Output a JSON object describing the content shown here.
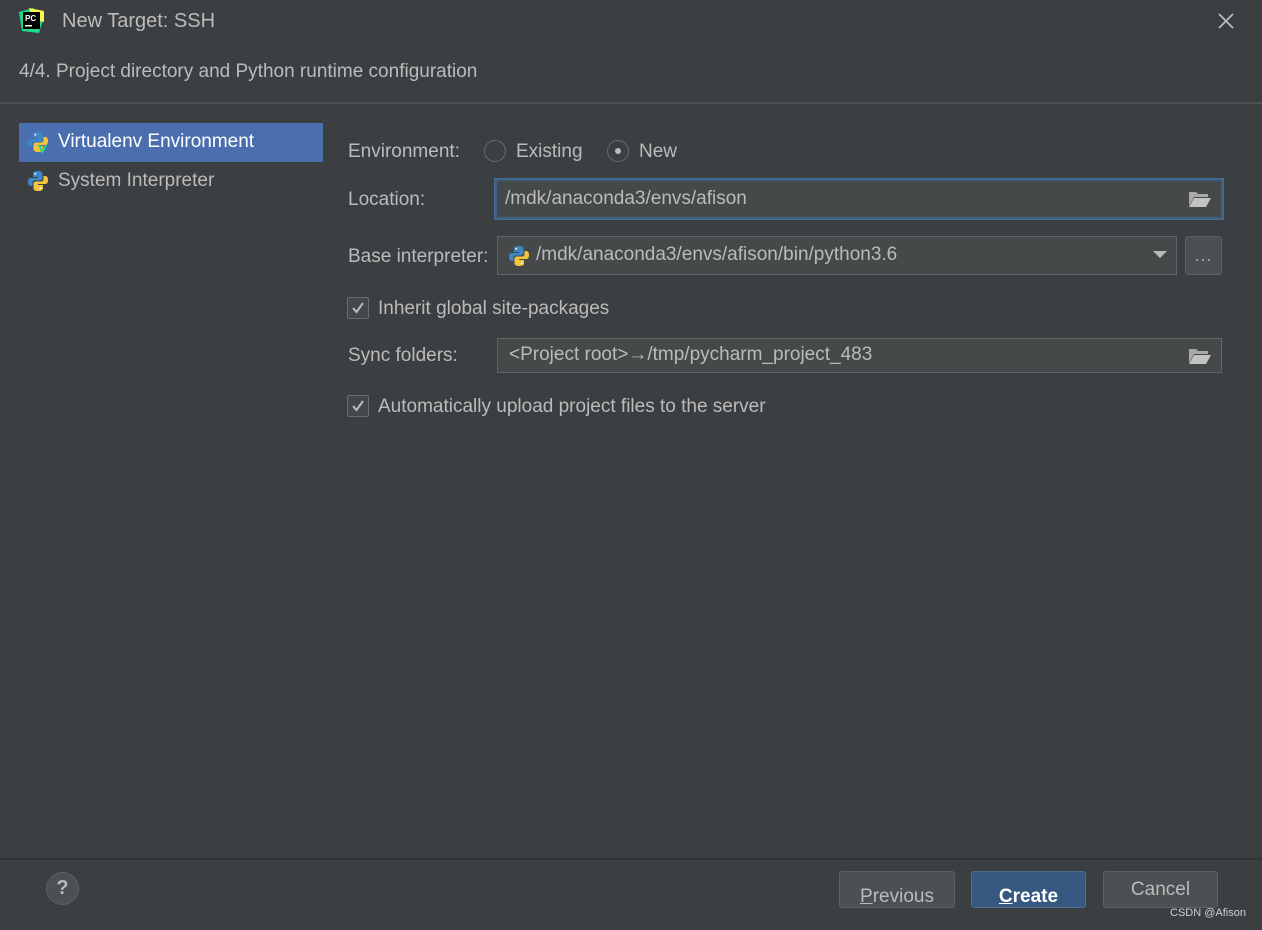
{
  "window": {
    "title": "New Target: SSH",
    "step_title": "4/4. Project directory and Python runtime configuration",
    "app_icon": "pycharm-icon",
    "app_icon_text": "PC",
    "close_icon": "close-icon"
  },
  "sidebar": {
    "items": [
      {
        "label": "Virtualenv Environment",
        "icon": "virtualenv-python-icon",
        "selected": true
      },
      {
        "label": "System Interpreter",
        "icon": "python-icon",
        "selected": false
      }
    ]
  },
  "form": {
    "environment": {
      "label": "Environment:",
      "options": [
        {
          "label": "Existing",
          "checked": false
        },
        {
          "label": "New",
          "checked": true
        }
      ]
    },
    "location": {
      "label": "Location:",
      "value": "/mdk/anaconda3/envs/afison",
      "icon": "folder-icon"
    },
    "base_interpreter": {
      "label": "Base interpreter:",
      "value": "/mdk/anaconda3/envs/afison/bin/python3.6",
      "browse_label": "...",
      "icon": "python-icon"
    },
    "inherit": {
      "label": "Inherit global site-packages",
      "checked": true
    },
    "sync_folders": {
      "label": "Sync folders:",
      "value": "<Project root>→/tmp/pycharm_project_483",
      "icon": "folder-icon"
    },
    "auto_upload": {
      "label": "Automatically upload project files to the server",
      "checked": true
    }
  },
  "footer": {
    "help_label": "?",
    "previous": {
      "mnemonic": "P",
      "rest": "revious"
    },
    "create": {
      "mnemonic": "C",
      "rest": "reate"
    },
    "cancel": "Cancel"
  },
  "watermark": "CSDN @Afison",
  "colors": {
    "background": "#3c3f41",
    "selection": "#4b6eaf",
    "primary_button": "#365880",
    "focus_border": "#3d6185",
    "text": "#bbbbbb"
  }
}
